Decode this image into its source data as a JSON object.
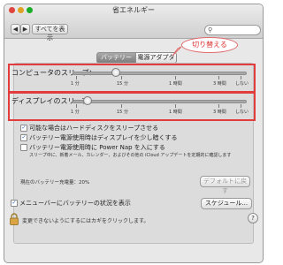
{
  "window": {
    "title": "省エネルギー"
  },
  "toolbar": {
    "show_all_label": "すべてを表示",
    "back_label": "◀",
    "forward_label": "▶"
  },
  "search": {
    "placeholder": "",
    "icon": "search-icon"
  },
  "tabs": [
    {
      "label": "バッテリー",
      "selected": true
    },
    {
      "label": "電源アダプタ",
      "selected": false
    }
  ],
  "annotation": {
    "text": "切り替える"
  },
  "sliders": [
    {
      "label": "コンピュータのスリープ：",
      "ticks": [
        "1 分",
        "15 分",
        "1 時間",
        "3 時間",
        "しない"
      ],
      "value": "10 分"
    },
    {
      "label": "ディスプレイのスリープ：",
      "ticks": [
        "1 分",
        "15 分",
        "1 時間",
        "3 時間",
        "しない"
      ],
      "value": "2 分"
    }
  ],
  "options": [
    {
      "label": "可能な場合はハードディスクをスリープさせる",
      "checked": true
    },
    {
      "label": "バッテリー電源使用時はディスプレイを少し暗くする",
      "checked": true
    },
    {
      "label": "バッテリー電源使用時に Power Nap を入にする",
      "checked": false,
      "description": "スリープ中に、新着メール、カレンダー、およびその他の iCloud アップデートを定期的に確認します"
    }
  ],
  "status": {
    "battery_level": "現在のバッテリー充電量：20%"
  },
  "buttons": {
    "restore_defaults": "デフォルトに戻す",
    "schedule": "スケジュール...",
    "help": "?"
  },
  "menubar_option": {
    "label": "メニューバーにバッテリーの状況を表示",
    "checked": true
  },
  "lock": {
    "text": "変更できないようにするにはカギをクリックします。"
  }
}
